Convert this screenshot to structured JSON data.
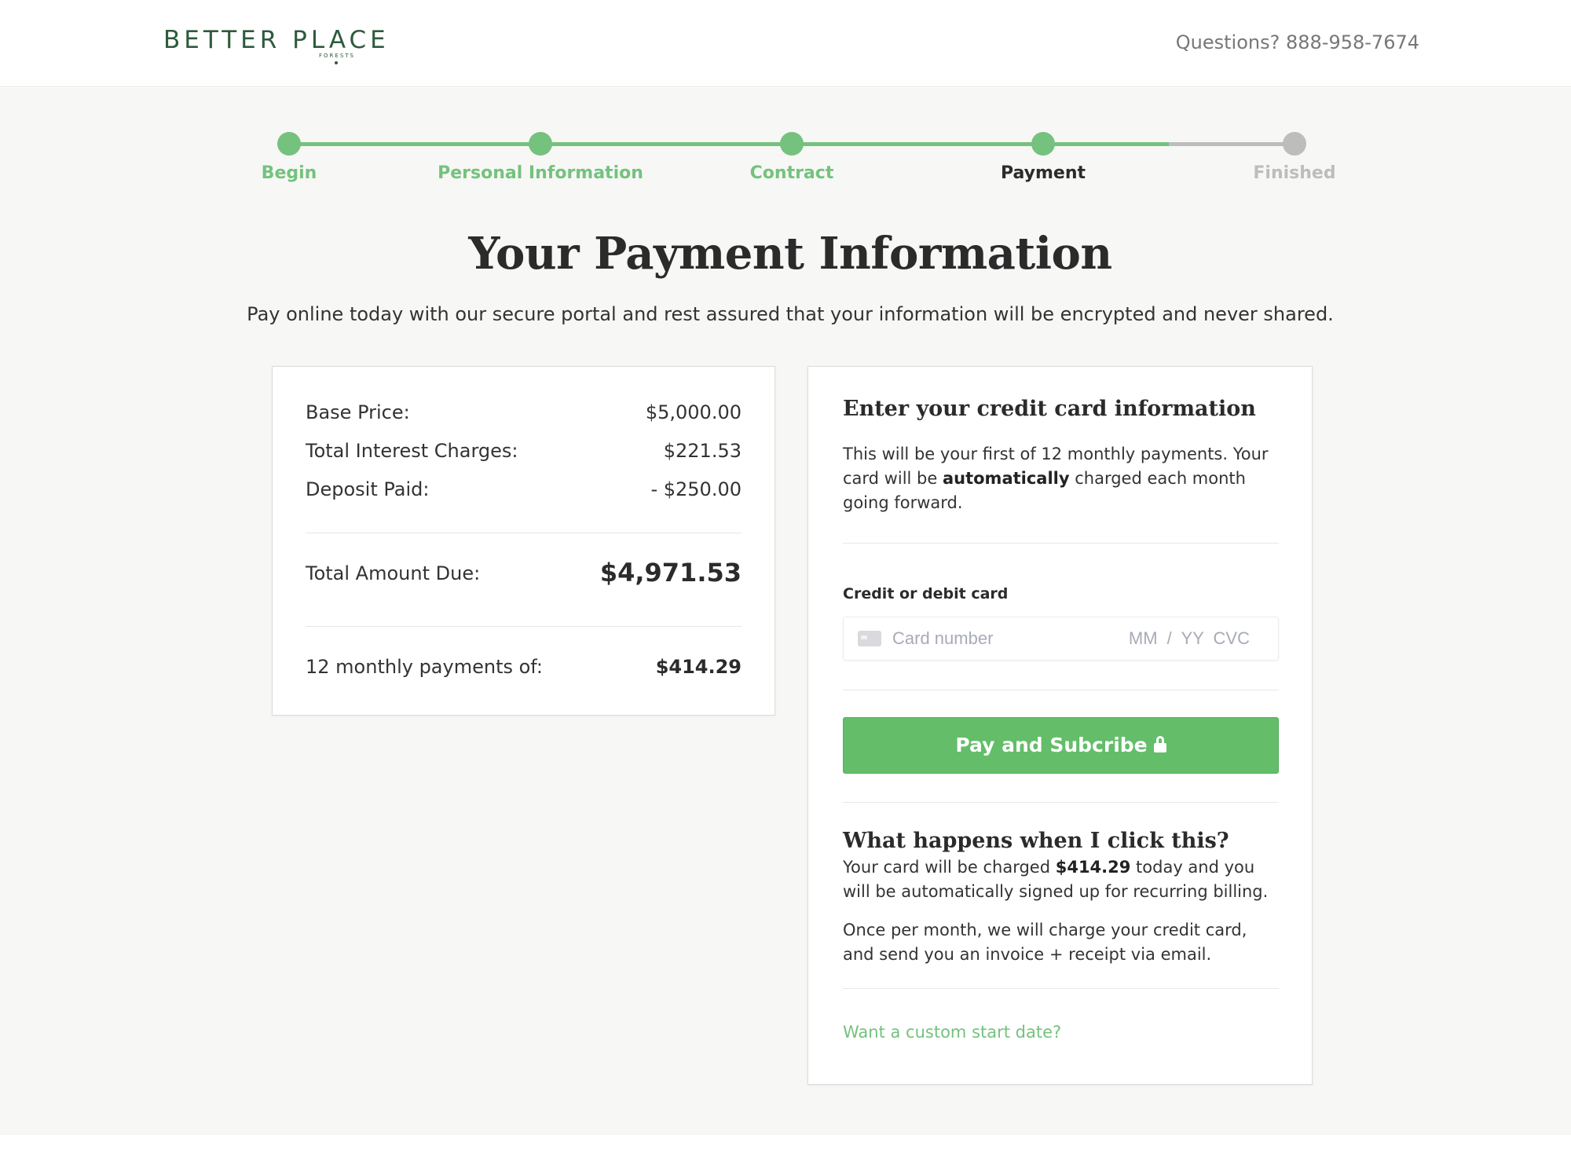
{
  "header": {
    "logo_text": "BETTER PLACE",
    "logo_subtext": "FORESTS",
    "phone_text": "Questions? 888-958-7674"
  },
  "colors": {
    "accent_green": "#74c27d",
    "button_green": "#63bd69",
    "inactive_gray": "#bdbdbd",
    "logo_green": "#2e5a3c"
  },
  "stepper": {
    "steps": [
      {
        "label": "Begin",
        "state": "done"
      },
      {
        "label": "Personal Information",
        "state": "done"
      },
      {
        "label": "Contract",
        "state": "done"
      },
      {
        "label": "Payment",
        "state": "current"
      },
      {
        "label": "Finished",
        "state": "todo"
      }
    ]
  },
  "page": {
    "title": "Your Payment Information",
    "subtitle": "Pay online today with our secure portal and rest assured that your information will be encrypted and never shared."
  },
  "summary": {
    "base_price_label": "Base Price:",
    "base_price_value": "$5,000.00",
    "interest_label": "Total Interest Charges:",
    "interest_value": "$221.53",
    "deposit_label": "Deposit Paid:",
    "deposit_value": "- $250.00",
    "total_label": "Total Amount Due:",
    "total_value": "$4,971.53",
    "monthly_label": "12 monthly payments of:",
    "monthly_value": "$414.29"
  },
  "payment": {
    "title": "Enter your credit card information",
    "intro_part1": "This will be your first of 12 monthly payments. Your card will be ",
    "intro_bold": "automatically",
    "intro_part2": " charged each month going forward.",
    "card_field_label": "Credit or debit card",
    "card_number_placeholder": "Card number",
    "card_expiry_placeholder": "MM / YY",
    "card_cvc_placeholder": "CVC",
    "card_icon": "credit-card-icon",
    "submit_label": "Pay and Subcribe",
    "submit_icon": "lock-icon",
    "faq_title": "What happens when I click this?",
    "faq_p1_part1": "Your card will be charged ",
    "faq_p1_bold": "$414.29",
    "faq_p1_part2": " today and you will be automatically signed up for recurring billing.",
    "faq_p2": "Once per month, we will charge your credit card, and send you an invoice + receipt via email.",
    "custom_date_link": "Want a custom start date?"
  }
}
